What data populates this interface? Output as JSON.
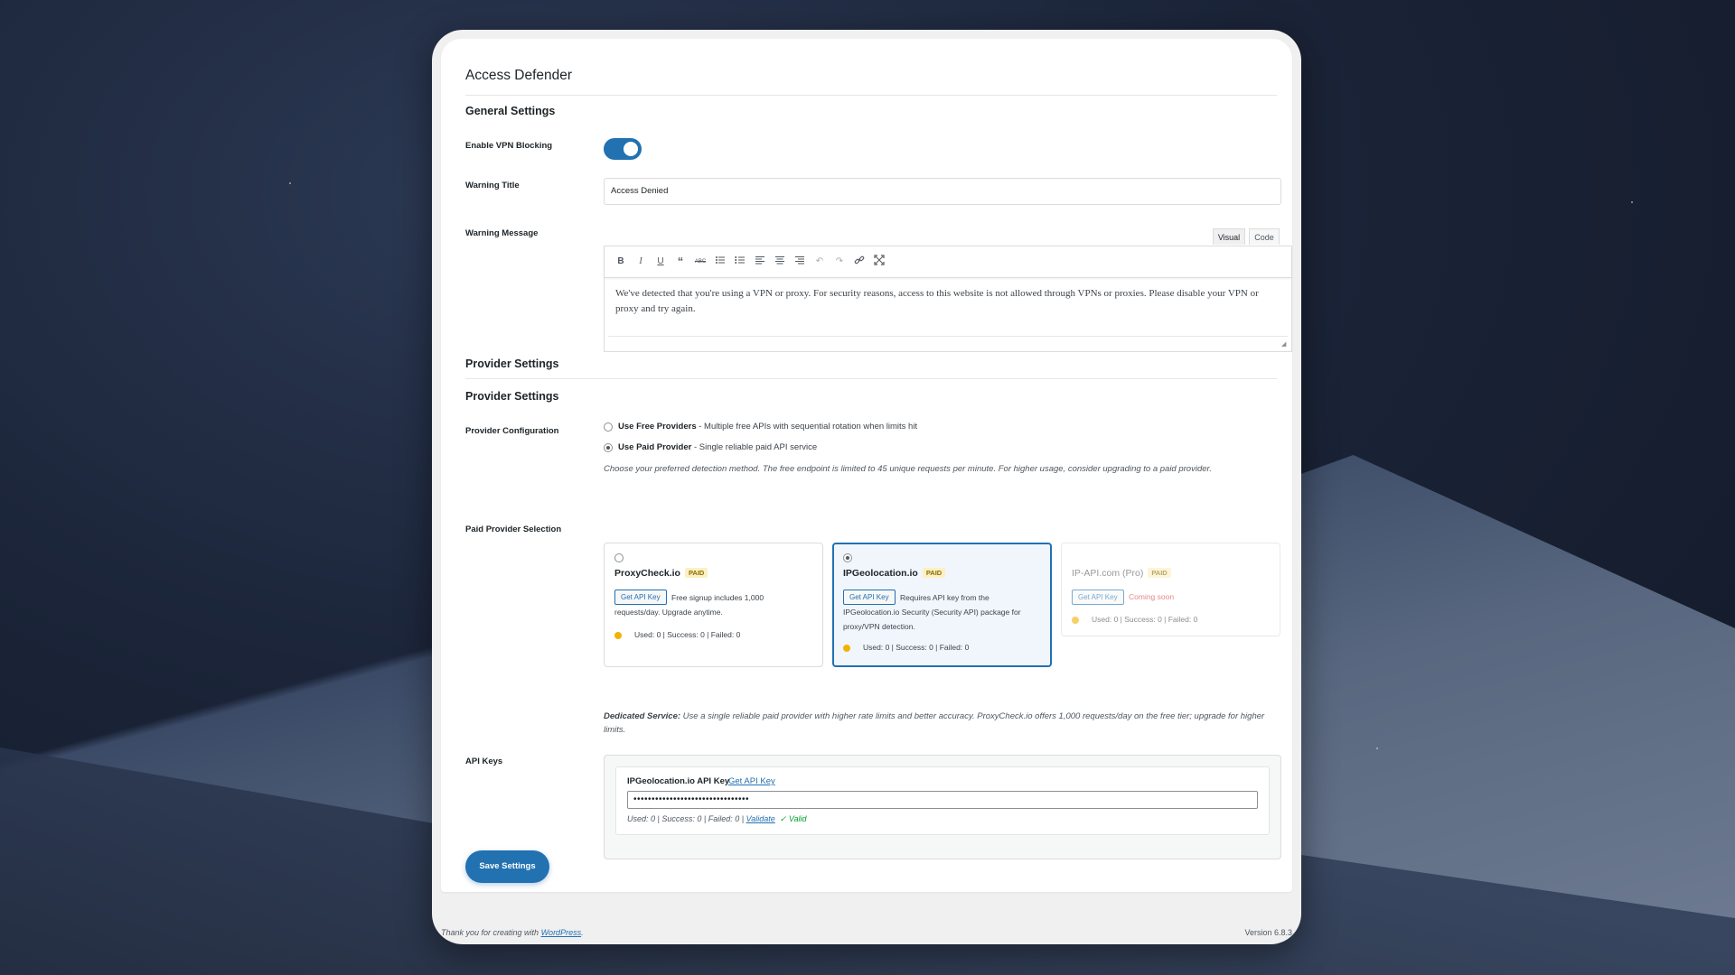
{
  "page": {
    "title": "Access Defender"
  },
  "general": {
    "title": "General Settings",
    "vpn_label": "Enable VPN Blocking",
    "warning_title_label": "Warning Title",
    "warning_title_value": "Access Denied",
    "warning_message_label": "Warning Message",
    "tab_visual": "Visual",
    "tab_code": "Code",
    "warning_message_text": "We've detected that you're using a VPN or proxy. For security reasons, access to this website is not allowed through VPNs or proxies. Please disable your VPN or proxy and try again."
  },
  "toolbar_icons": [
    "bold-icon",
    "italic-icon",
    "underline-icon",
    "blockquote-icon",
    "strikethrough-icon",
    "bullet-list-icon",
    "numbered-list-icon",
    "align-left-icon",
    "align-center-icon",
    "align-right-icon",
    "undo-icon",
    "redo-icon",
    "link-icon",
    "fullscreen-icon"
  ],
  "provider": {
    "section_title": "Provider Settings",
    "sub_title": "Provider Settings",
    "config_label": "Provider Configuration",
    "free_bold": "Use Free Providers",
    "free_desc": " - Multiple free APIs with sequential rotation when limits hit",
    "paid_bold": "Use Paid Provider",
    "paid_desc": " - Single reliable paid API service",
    "hint": "Choose your preferred detection method. The free endpoint is limited to 45 unique requests per minute. For higher usage, consider upgrading to a paid provider.",
    "selection_label": "Paid Provider Selection"
  },
  "cards": [
    {
      "name": "ProxyCheck.io",
      "badge": "PAID",
      "button": "Get API Key",
      "desc_line1": "Free signup includes 1,000",
      "desc_line2": "requests/day. Upgrade anytime.",
      "usage": "Used: 0 | Success: 0 | Failed: 0"
    },
    {
      "name": "IPGeolocation.io",
      "badge": "PAID",
      "button": "Get API Key",
      "desc_line1": "Requires API key from the",
      "desc_line2": "IPGeolocation.io Security (Security API) package for",
      "desc_line3": "proxy/VPN detection.",
      "usage": "Used: 0 | Success: 0 | Failed: 0"
    },
    {
      "name": "IP-API.com (Pro)",
      "badge": "PAID",
      "button": "Get API Key",
      "coming": "Coming soon",
      "usage": "Used: 0 | Success: 0 | Failed: 0"
    }
  ],
  "dedicated": {
    "bold": "Dedicated Service:",
    "text": " Use a single reliable paid provider with higher rate limits and better accuracy. ProxyCheck.io offers 1,000 requests/day on the free tier; upgrade for higher limits."
  },
  "api": {
    "label": "API Keys",
    "key_label": "IPGeolocation.io API Key",
    "get_key": "Get API Key",
    "masked_value": "••••••••••••••••••••••••••••••••",
    "usage": "Used: 0 | Success: 0 | Failed: 0 | ",
    "validate": "Validate",
    "valid": "✓ Valid"
  },
  "save_label": "Save Settings",
  "footer": {
    "thanks": "Thank you for creating with ",
    "wp": "WordPress",
    "dot": ".",
    "version": "Version 6.8.3"
  },
  "colors": {
    "accent": "#2271b1",
    "warning_dot": "#f0b400",
    "valid": "#00a32a",
    "coming_soon": "#d63638"
  }
}
